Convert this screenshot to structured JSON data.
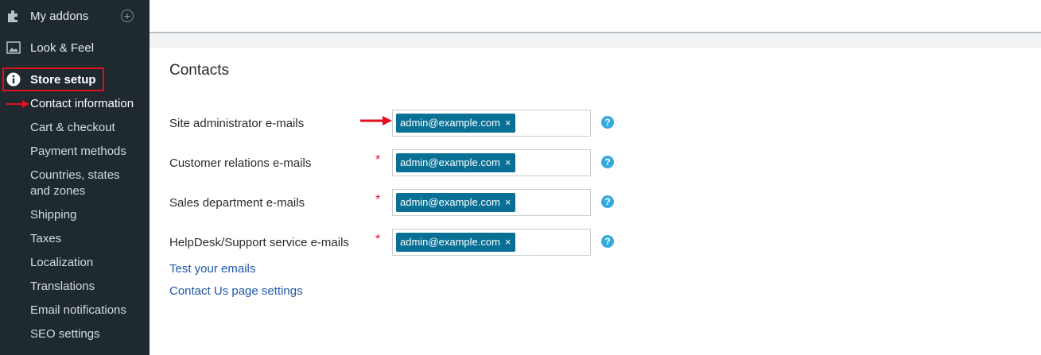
{
  "sidebar": {
    "top_items": [
      {
        "label": "My addons",
        "icon": "puzzle-icon"
      },
      {
        "label": "Look & Feel",
        "icon": "image-icon"
      },
      {
        "label": "Store setup",
        "icon": "info-icon"
      }
    ],
    "add_symbol": "+",
    "submenu": [
      "Contact information",
      "Cart & checkout",
      "Payment methods",
      "Countries, states and zones",
      "Shipping",
      "Taxes",
      "Localization",
      "Translations",
      "Email notifications",
      "SEO settings"
    ]
  },
  "main": {
    "title": "Contacts",
    "fields": [
      {
        "label": "Site administrator e-mails",
        "required": false,
        "tag": "admin@example.com"
      },
      {
        "label": "Customer relations e-mails",
        "required": true,
        "tag": "admin@example.com"
      },
      {
        "label": "Sales department e-mails",
        "required": true,
        "tag": "admin@example.com"
      },
      {
        "label": "HelpDesk/Support service e-mails",
        "required": true,
        "tag": "admin@example.com"
      }
    ],
    "required_mark": "*",
    "remove_symbol": "×",
    "help_symbol": "?",
    "links": [
      "Test your emails",
      "Contact Us page settings"
    ]
  },
  "colors": {
    "sidebar_bg": "#1e2a30",
    "tag_bg": "#087095",
    "help_bg": "#36a9e1",
    "link": "#1f57a8",
    "annotation": "#e3101c"
  }
}
